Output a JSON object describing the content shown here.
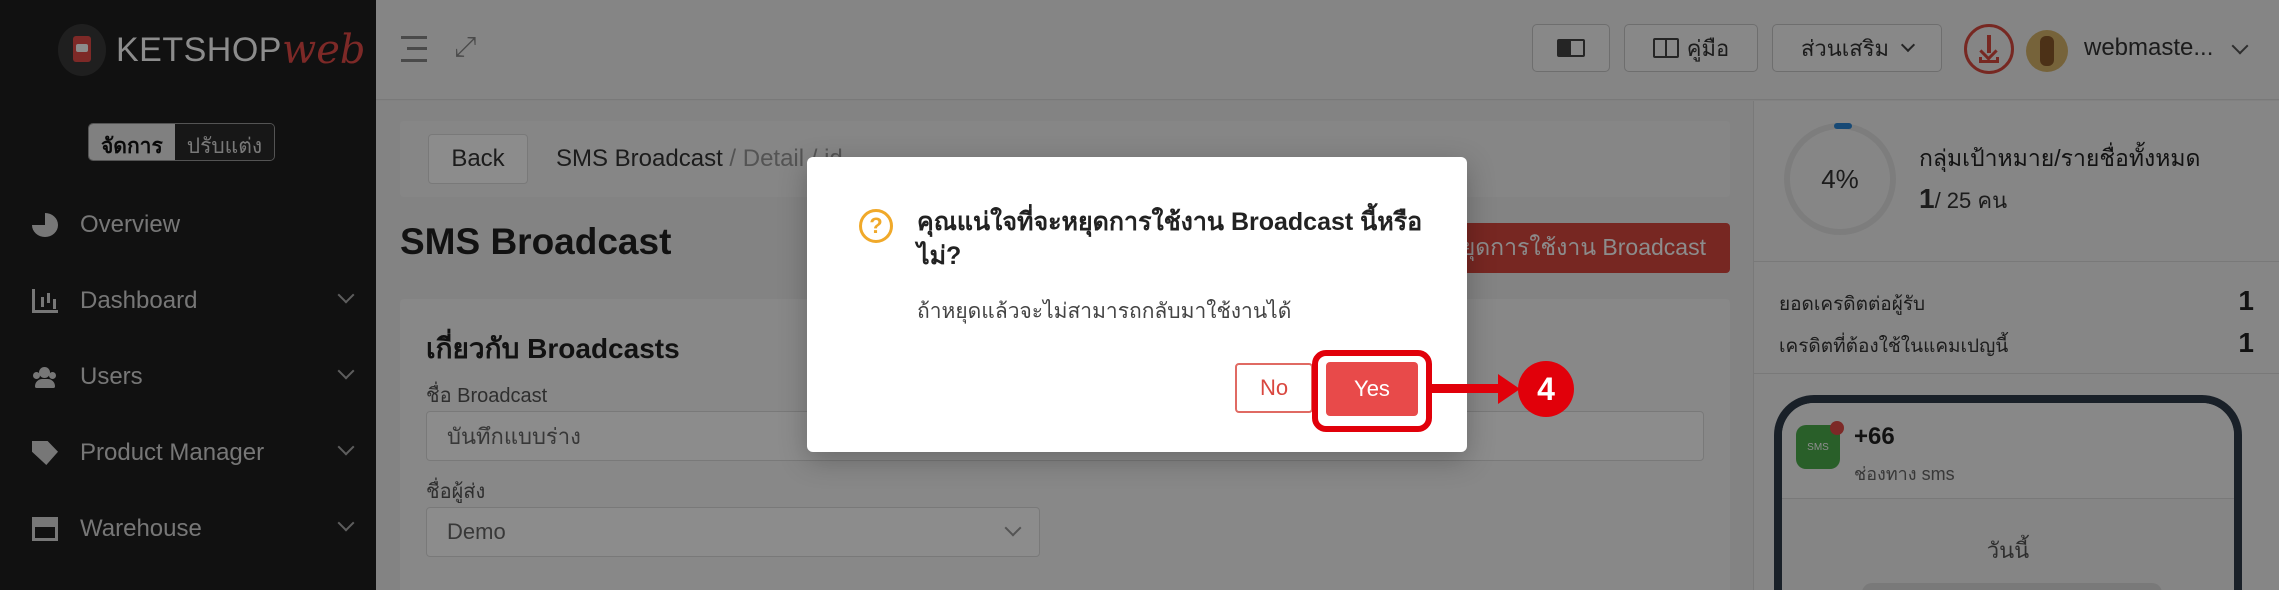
{
  "sidebar": {
    "logo_main": "KETSHOP",
    "logo_accent": "web",
    "mode_active": "จัดการ",
    "mode_inactive": "ปรับแต่ง",
    "items": [
      {
        "label": "Overview",
        "icon": "pie-chart-icon"
      },
      {
        "label": "Dashboard",
        "icon": "bar-chart-icon"
      },
      {
        "label": "Users",
        "icon": "users-icon"
      },
      {
        "label": "Product Manager",
        "icon": "tag-icon"
      },
      {
        "label": "Warehouse",
        "icon": "warehouse-icon"
      }
    ]
  },
  "topbar": {
    "manual_label": "คู่มือ",
    "addon_label": "ส่วนเสริม",
    "username": "webmaste..."
  },
  "main": {
    "back_label": "Back",
    "breadcrumb_current": "SMS Broadcast",
    "breadcrumb_rest": " / Detail / id",
    "page_title": "SMS Broadcast",
    "stop_button_label": "หยุดการใช้งาน Broadcast",
    "card_title": "เกี่ยวกับ Broadcasts",
    "broadcast_name_label": "ชื่อ Broadcast",
    "broadcast_name_value": "บันทึกแบบร่าง",
    "sender_label": "ชื่อผู้ส่ง",
    "sender_value": "Demo"
  },
  "right_panel": {
    "gauge_percent": "4%",
    "target_title": "กลุ่มเป้าหมาย/รายชื่อทั้งหมด",
    "target_count": "1",
    "target_total": "/ 25 คน",
    "credit_per_recipient_label": "ยอดเครดิตต่อผู้รับ",
    "credit_per_recipient_value": "1",
    "credit_needed_label": "เครดิตที่ต้องใช้ในแคมเปญนี้",
    "credit_needed_value": "1",
    "phone_number": "+66",
    "phone_channel": "ช่องทาง sms",
    "phone_today": "วันนี้",
    "sms_icon_text": "SMS"
  },
  "modal": {
    "title": "คุณแน่ใจที่จะหยุดการใช้งาน Broadcast นี้หรือไม่?",
    "message": "ถ้าหยุดแล้วจะไม่สามารถกลับมาใช้งานได้",
    "no_label": "No",
    "yes_label": "Yes"
  },
  "annotation": {
    "step_number": "4",
    "color": "#e1000a"
  }
}
